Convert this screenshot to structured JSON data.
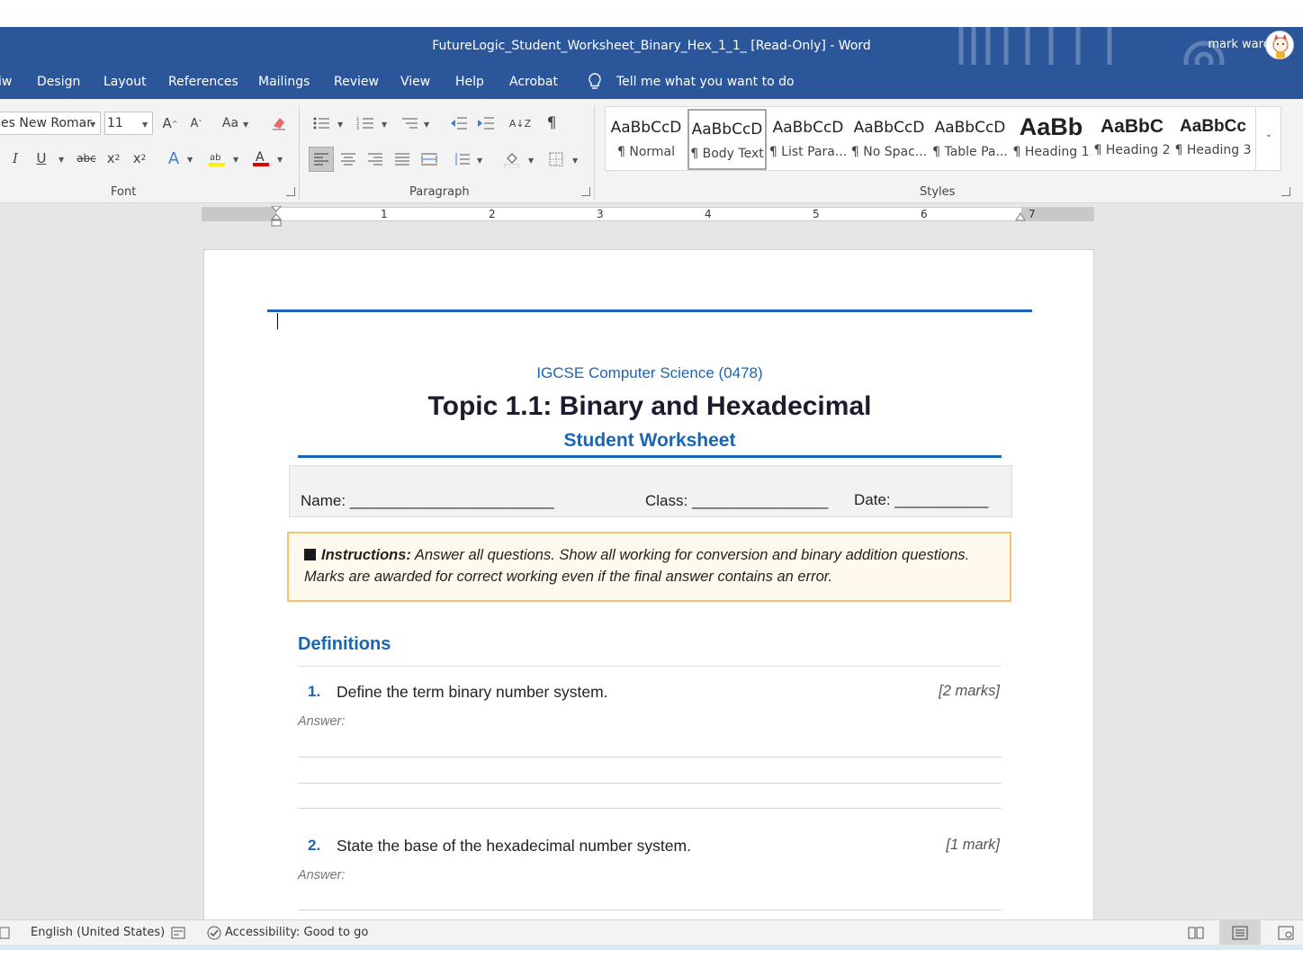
{
  "window": {
    "title": "FutureLogic_Student_Worksheet_Binary_Hex_1_1_ [Read-Only]  -  Word",
    "user": "mark ward"
  },
  "menu": {
    "tabs": [
      "iw",
      "Design",
      "Layout",
      "References",
      "Mailings",
      "Review",
      "View",
      "Help",
      "Acrobat"
    ],
    "tell_me": "Tell me what you want to do"
  },
  "ribbon": {
    "font_name": "es New Romar",
    "font_size": "11",
    "groups": {
      "font": "Font",
      "paragraph": "Paragraph",
      "styles": "Styles"
    },
    "styles": [
      {
        "sample": "AaBbCcD",
        "name": "¶ Normal"
      },
      {
        "sample": "AaBbCcD",
        "name": "¶ Body Text"
      },
      {
        "sample": "AaBbCcD",
        "name": "¶ List Para..."
      },
      {
        "sample": "AaBbCcD",
        "name": "¶ No Spac..."
      },
      {
        "sample": "AaBbCcD",
        "name": "¶ Table Pa..."
      },
      {
        "sample": "AaBb",
        "name": "¶ Heading 1"
      },
      {
        "sample": "AaBbC",
        "name": "¶ Heading 2"
      },
      {
        "sample": "AaBbCc",
        "name": "¶ Heading 3"
      }
    ]
  },
  "ruler": {
    "numbers": [
      "1",
      "2",
      "3",
      "4",
      "5",
      "6",
      "7"
    ]
  },
  "document": {
    "course": "IGCSE Computer Science (0478)",
    "topic": "Topic 1.1: Binary and Hexadecimal",
    "subtitle": "Student Worksheet",
    "name_label": "Name: ________________________",
    "class_label": "Class: ________________",
    "date_label": "Date: ___________",
    "instructions_bold": "Instructions:",
    "instructions_line1": " Answer all questions. Show all working for conversion and binary addition questions.",
    "instructions_line2": "Marks are awarded for correct working even if the final answer contains an error.",
    "section": "Definitions",
    "questions": [
      {
        "num": "1.",
        "text": "Define the term binary number system.",
        "marks": "[2 marks]",
        "answer": "Answer:"
      },
      {
        "num": "2.",
        "text": "State the base of the hexadecimal number system.",
        "marks": "[1 mark]",
        "answer": "Answer:"
      }
    ]
  },
  "status": {
    "language": "English (United States)",
    "accessibility": "Accessibility: Good to go"
  },
  "colors": {
    "word_blue": "#2b579a",
    "doc_blue": "#1a66b5",
    "instructions_border": "#f2c46d",
    "instructions_bg": "#fffaed"
  }
}
